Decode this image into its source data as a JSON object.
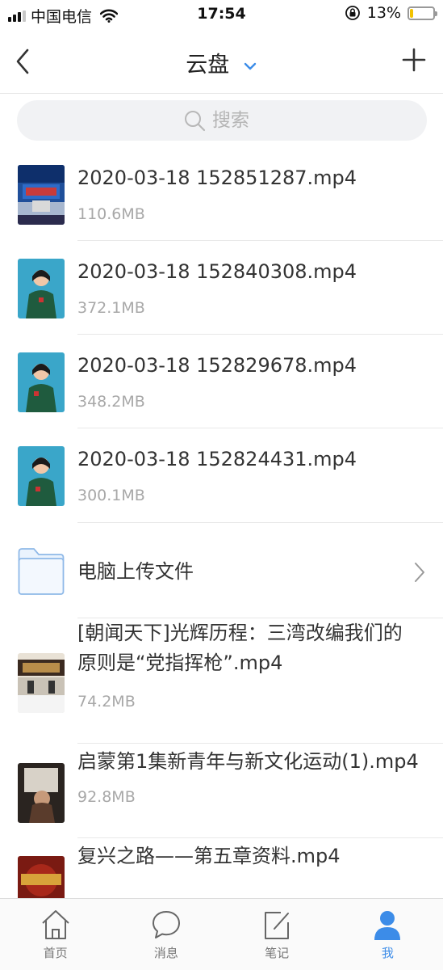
{
  "status_bar": {
    "carrier": "中国电信",
    "time": "17:54",
    "battery_percent": "13%",
    "battery_level": 0.13
  },
  "nav": {
    "title": "云盘",
    "back_icon": "chevron-left-icon",
    "add_icon": "plus-icon"
  },
  "search": {
    "placeholder": "搜索"
  },
  "files": [
    {
      "name": "2020-03-18 152851287.mp4",
      "size": "110.6MB",
      "type": "video"
    },
    {
      "name": "2020-03-18 152840308.mp4",
      "size": "372.1MB",
      "type": "video"
    },
    {
      "name": "2020-03-18 152829678.mp4",
      "size": "348.2MB",
      "type": "video"
    },
    {
      "name": "2020-03-18 152824431.mp4",
      "size": "300.1MB",
      "type": "video"
    },
    {
      "name": "电脑上传文件",
      "type": "folder"
    },
    {
      "name": "[朝闻天下]光辉历程：三湾改编我们的原则是“党指挥枪”.mp4",
      "size": "74.2MB",
      "type": "video"
    },
    {
      "name": "启蒙第1集新青年与新文化运动(1).mp4",
      "size": "92.8MB",
      "type": "video"
    },
    {
      "name": "复兴之路——第五章资料.mp4",
      "type": "video"
    }
  ],
  "tabs": [
    {
      "label": "首页",
      "icon": "home-icon"
    },
    {
      "label": "消息",
      "icon": "message-icon"
    },
    {
      "label": "笔记",
      "icon": "note-icon"
    },
    {
      "label": "我",
      "icon": "user-icon",
      "active": true
    }
  ],
  "colors": {
    "accent": "#3c8ce8",
    "battery": "#f2c200"
  }
}
